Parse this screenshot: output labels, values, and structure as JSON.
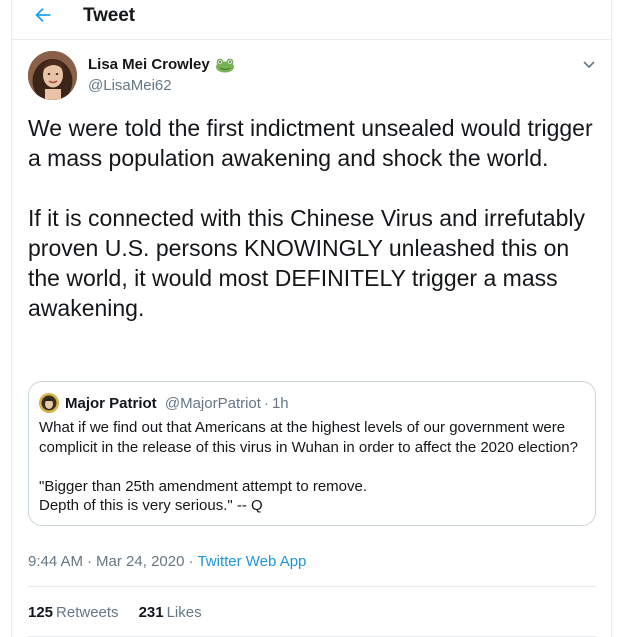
{
  "header": {
    "title": "Tweet",
    "back_icon": "arrow-left-icon",
    "accent": "#1da1f2"
  },
  "tweet": {
    "author": {
      "display_name": "Lisa Mei Crowley",
      "emoji_icon": "frog-icon",
      "handle": "@LisaMei62",
      "avatar_icon": "user-avatar"
    },
    "menu_icon": "chevron-down-icon",
    "text": "We were told the first indictment unsealed would trigger a mass population awakening and shock the world.\n\nIf it is connected with this Chinese Virus and irrefutably proven U.S. persons KNOWINGLY unleashed this on the world, it would most DEFINITELY trigger a mass awakening.",
    "quote": {
      "name": "Major Patriot",
      "handle": "@MajorPatriot",
      "separator": "·",
      "time": "1h",
      "text": "What if we find out that Americans at the highest levels of our government were complicit in the release of this virus in Wuhan in order to affect the 2020 election?\n\n\"Bigger than 25th amendment attempt to remove.\nDepth of this is very serious.\" -- Q"
    },
    "meta": {
      "time": "9:44 AM",
      "separator": "·",
      "date": "Mar 24, 2020",
      "source": "Twitter Web App",
      "link_color": "#1b95e0"
    },
    "stats": {
      "retweets_count": "125",
      "retweets_label": "Retweets",
      "likes_count": "231",
      "likes_label": "Likes"
    }
  }
}
